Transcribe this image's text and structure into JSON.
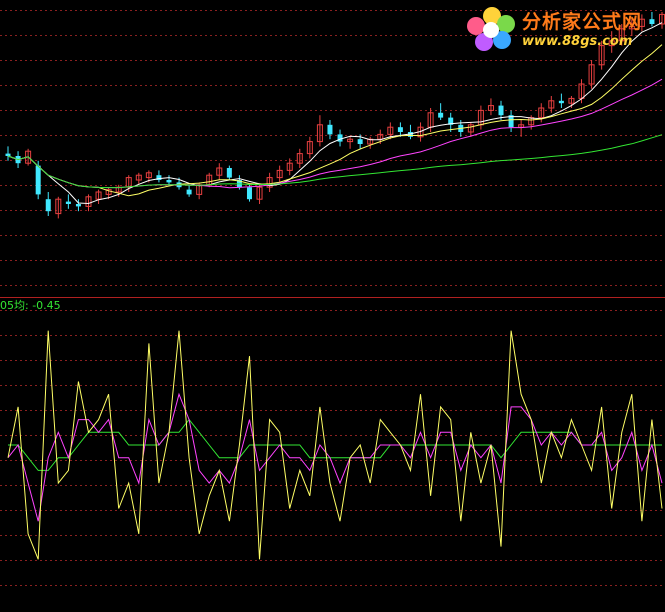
{
  "indicator_label": "05均: -0.45",
  "watermark": {
    "title": "分析家公式网",
    "url": "www.88gs.com"
  },
  "colors": {
    "background": "#000000",
    "grid": "#8a2020",
    "separator": "#b02020",
    "up_candle": "#e84040",
    "down_candle": "#40e8ff",
    "ma_short": "#ffffff",
    "ma_mid": "#ffff66",
    "ma_long": "#ff44ff",
    "ma_xlong": "#33e633",
    "osc_main": "#ffff66",
    "osc_signal": "#ff44ff",
    "osc_slow": "#33e633"
  },
  "chart_data": [
    {
      "type": "candlestick",
      "title": "",
      "yrange": [
        0,
        100
      ],
      "grid": true,
      "candles": [
        {
          "o": 41,
          "h": 44,
          "l": 38,
          "c": 40
        },
        {
          "o": 40,
          "h": 42,
          "l": 35,
          "c": 37
        },
        {
          "o": 37,
          "h": 43,
          "l": 36,
          "c": 42
        },
        {
          "o": 36,
          "h": 38,
          "l": 22,
          "c": 24
        },
        {
          "o": 22,
          "h": 25,
          "l": 15,
          "c": 17
        },
        {
          "o": 16,
          "h": 23,
          "l": 14,
          "c": 22
        },
        {
          "o": 21,
          "h": 24,
          "l": 18,
          "c": 20
        },
        {
          "o": 20,
          "h": 22,
          "l": 17,
          "c": 19
        },
        {
          "o": 19,
          "h": 24,
          "l": 17,
          "c": 23
        },
        {
          "o": 22,
          "h": 26,
          "l": 20,
          "c": 25
        },
        {
          "o": 24,
          "h": 27,
          "l": 22,
          "c": 26
        },
        {
          "o": 25,
          "h": 28,
          "l": 23,
          "c": 27
        },
        {
          "o": 27,
          "h": 32,
          "l": 25,
          "c": 31
        },
        {
          "o": 30,
          "h": 33,
          "l": 28,
          "c": 32
        },
        {
          "o": 31,
          "h": 34,
          "l": 29,
          "c": 33
        },
        {
          "o": 32,
          "h": 34,
          "l": 29,
          "c": 30
        },
        {
          "o": 30,
          "h": 32,
          "l": 28,
          "c": 29
        },
        {
          "o": 29,
          "h": 31,
          "l": 26,
          "c": 27
        },
        {
          "o": 26,
          "h": 28,
          "l": 23,
          "c": 24
        },
        {
          "o": 24,
          "h": 29,
          "l": 22,
          "c": 28
        },
        {
          "o": 28,
          "h": 33,
          "l": 27,
          "c": 32
        },
        {
          "o": 32,
          "h": 37,
          "l": 30,
          "c": 35
        },
        {
          "o": 35,
          "h": 36,
          "l": 30,
          "c": 31
        },
        {
          "o": 30,
          "h": 32,
          "l": 26,
          "c": 27
        },
        {
          "o": 27,
          "h": 28,
          "l": 21,
          "c": 22
        },
        {
          "o": 22,
          "h": 28,
          "l": 20,
          "c": 27
        },
        {
          "o": 27,
          "h": 33,
          "l": 25,
          "c": 31
        },
        {
          "o": 31,
          "h": 36,
          "l": 29,
          "c": 34
        },
        {
          "o": 34,
          "h": 39,
          "l": 32,
          "c": 37
        },
        {
          "o": 37,
          "h": 43,
          "l": 35,
          "c": 41
        },
        {
          "o": 41,
          "h": 48,
          "l": 39,
          "c": 46
        },
        {
          "o": 46,
          "h": 57,
          "l": 44,
          "c": 53
        },
        {
          "o": 53,
          "h": 55,
          "l": 47,
          "c": 49
        },
        {
          "o": 49,
          "h": 51,
          "l": 44,
          "c": 46
        },
        {
          "o": 46,
          "h": 48,
          "l": 43,
          "c": 47
        },
        {
          "o": 47,
          "h": 49,
          "l": 43,
          "c": 45
        },
        {
          "o": 45,
          "h": 48,
          "l": 43,
          "c": 47
        },
        {
          "o": 47,
          "h": 51,
          "l": 45,
          "c": 49
        },
        {
          "o": 49,
          "h": 54,
          "l": 47,
          "c": 52
        },
        {
          "o": 52,
          "h": 54,
          "l": 48,
          "c": 50
        },
        {
          "o": 50,
          "h": 53,
          "l": 47,
          "c": 48
        },
        {
          "o": 48,
          "h": 54,
          "l": 46,
          "c": 52
        },
        {
          "o": 52,
          "h": 60,
          "l": 50,
          "c": 58
        },
        {
          "o": 58,
          "h": 62,
          "l": 55,
          "c": 56
        },
        {
          "o": 56,
          "h": 58,
          "l": 50,
          "c": 53
        },
        {
          "o": 53,
          "h": 55,
          "l": 48,
          "c": 50
        },
        {
          "o": 50,
          "h": 54,
          "l": 48,
          "c": 53
        },
        {
          "o": 53,
          "h": 61,
          "l": 51,
          "c": 59
        },
        {
          "o": 59,
          "h": 64,
          "l": 57,
          "c": 61
        },
        {
          "o": 61,
          "h": 63,
          "l": 55,
          "c": 57
        },
        {
          "o": 57,
          "h": 59,
          "l": 50,
          "c": 52
        },
        {
          "o": 52,
          "h": 55,
          "l": 48,
          "c": 53
        },
        {
          "o": 53,
          "h": 57,
          "l": 51,
          "c": 56
        },
        {
          "o": 56,
          "h": 62,
          "l": 54,
          "c": 60
        },
        {
          "o": 60,
          "h": 65,
          "l": 58,
          "c": 63
        },
        {
          "o": 63,
          "h": 66,
          "l": 60,
          "c": 62
        },
        {
          "o": 62,
          "h": 65,
          "l": 60,
          "c": 64
        },
        {
          "o": 64,
          "h": 72,
          "l": 62,
          "c": 70
        },
        {
          "o": 70,
          "h": 80,
          "l": 68,
          "c": 78
        },
        {
          "o": 78,
          "h": 88,
          "l": 76,
          "c": 86
        },
        {
          "o": 86,
          "h": 92,
          "l": 83,
          "c": 88
        },
        {
          "o": 88,
          "h": 95,
          "l": 86,
          "c": 93
        },
        {
          "o": 93,
          "h": 97,
          "l": 90,
          "c": 94
        },
        {
          "o": 94,
          "h": 99,
          "l": 92,
          "c": 97
        },
        {
          "o": 97,
          "h": 100,
          "l": 94,
          "c": 95
        },
        {
          "o": 95,
          "h": 100,
          "l": 93,
          "c": 99
        }
      ],
      "ma_periods": [
        5,
        10,
        20,
        60
      ]
    },
    {
      "type": "line",
      "title": "",
      "yrange": [
        -10,
        10
      ],
      "grid": true,
      "series": [
        {
          "color": "#ffff66",
          "values": [
            -1,
            3,
            -7,
            -9,
            9,
            -3,
            -2,
            5,
            1,
            2,
            4,
            -5,
            -3,
            -7,
            8,
            -3,
            1,
            9,
            -1,
            -7,
            -4,
            -2,
            -6,
            0,
            7,
            -9,
            2,
            1,
            -5,
            -2,
            -4,
            3,
            -3,
            -6,
            -1,
            0,
            -3,
            2,
            1,
            0,
            -2,
            4,
            -4,
            3,
            2,
            -6,
            1,
            -3,
            0,
            -8,
            9,
            4,
            2,
            -3,
            1,
            -1,
            2,
            0,
            -2,
            3,
            -5,
            1,
            4,
            -6,
            2,
            -5
          ]
        },
        {
          "color": "#ff44ff",
          "values": [
            -1,
            0,
            -3,
            -6,
            -1,
            1,
            -1,
            2,
            2,
            1,
            2,
            -1,
            -1,
            -3,
            2,
            0,
            1,
            4,
            2,
            -2,
            -3,
            -2,
            -3,
            -1,
            2,
            -2,
            -1,
            0,
            -1,
            -1,
            -2,
            0,
            -1,
            -3,
            -1,
            -1,
            -1,
            0,
            0,
            0,
            -1,
            1,
            -1,
            1,
            1,
            -2,
            0,
            -1,
            0,
            -3,
            3,
            3,
            2,
            0,
            1,
            0,
            1,
            0,
            0,
            1,
            -2,
            -1,
            1,
            -2,
            0,
            -3
          ]
        },
        {
          "color": "#33e633",
          "values": [
            0,
            0,
            -1,
            -2,
            -2,
            -1,
            -1,
            0,
            1,
            1,
            1,
            1,
            0,
            0,
            0,
            0,
            1,
            1,
            2,
            1,
            0,
            -1,
            -1,
            -1,
            0,
            0,
            0,
            0,
            0,
            0,
            -1,
            -1,
            -1,
            -1,
            -1,
            -1,
            -1,
            -1,
            0,
            0,
            0,
            0,
            0,
            0,
            0,
            0,
            0,
            0,
            0,
            -1,
            0,
            1,
            1,
            1,
            1,
            1,
            1,
            0,
            0,
            0,
            0,
            0,
            0,
            0,
            0,
            0
          ]
        }
      ]
    }
  ]
}
